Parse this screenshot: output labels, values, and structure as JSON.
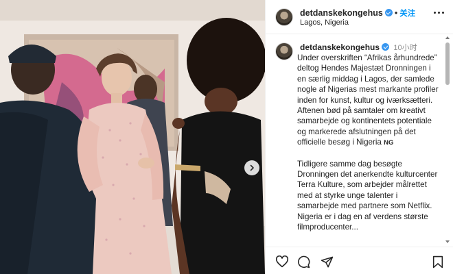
{
  "post": {
    "username": "detdanskekongehus",
    "follow_label": "关注",
    "location": "Lagos, Nigeria",
    "timestamp": "10小时",
    "caption_paragraphs": [
      "Under overskriften “Afrikas århundrede” deltog Hendes Majestæt Dronningen i en særlig middag i Lagos, der samlede nogle af Nigerias mest markante profiler inden for kunst, kultur og iværksætteri. Aftenen bød på samtaler om kreativt samarbejde og kontinentets potentiale og markerede afslutningen på det officielle besøg i Nigeria",
      "Tidligere samme dag besøgte Dronningen det anerkendte kulturcenter Terra Kulture, som arbejder målrettet med at styrke unge talenter i samarbejde med partnere som Netflix. Nigeria er i dag en af verdens største filmproducenter..."
    ],
    "flag_emoji_text": "NG"
  },
  "icons": {
    "verified": "verified-badge-icon",
    "more": "more-options-icon",
    "next": "chevron-right-icon",
    "like": "heart-icon",
    "comment": "comment-icon",
    "share": "send-icon",
    "save": "bookmark-icon"
  },
  "colors": {
    "accent_blue": "#0095f6",
    "verified_blue": "#3897f0",
    "muted_text": "#8e8e8e"
  }
}
